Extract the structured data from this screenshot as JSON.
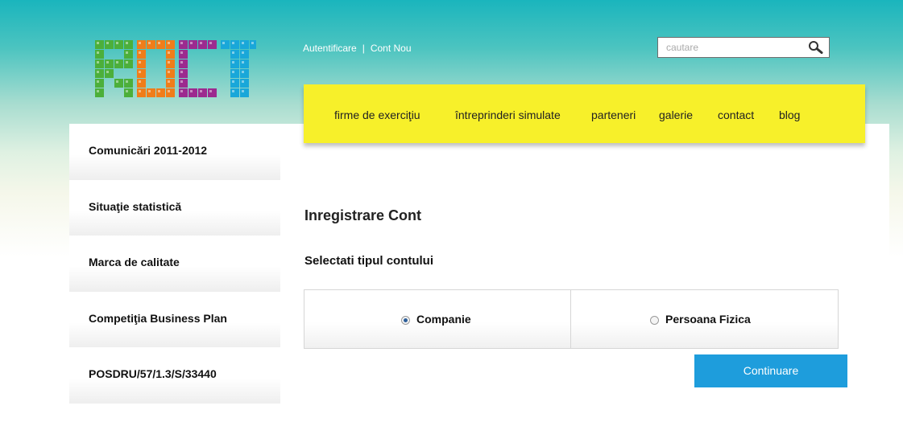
{
  "brand": {
    "logo_text": "ROCT"
  },
  "top_links": {
    "login": "Autentificare",
    "separator": "|",
    "register": "Cont Nou"
  },
  "search": {
    "placeholder": "cautare"
  },
  "nav": {
    "items": [
      {
        "label": "firme de exerciţiu"
      },
      {
        "label": "întreprinderi simulate"
      },
      {
        "label": "parteneri"
      },
      {
        "label": "galerie"
      },
      {
        "label": "contact"
      },
      {
        "label": "blog"
      }
    ]
  },
  "sidebar": {
    "items": [
      {
        "label": "Comunicări 2011-2012"
      },
      {
        "label": "Situaţie statistică"
      },
      {
        "label": "Marca de calitate"
      },
      {
        "label": "Competiţia Business Plan"
      },
      {
        "label": "POSDRU/57/1.3/S/33440"
      }
    ]
  },
  "main": {
    "title": "Inregistrare Cont",
    "subtitle": "Selectati tipul contului",
    "options": [
      {
        "label": "Companie",
        "checked": true
      },
      {
        "label": "Persoana Fizica",
        "checked": false
      }
    ],
    "continue_label": "Continuare"
  },
  "colors": {
    "header_teal": "#1ab5bd",
    "nav_yellow": "#f7f02a",
    "button_blue": "#1e9ddc",
    "logo_green": "#4caf3a",
    "logo_orange": "#f07d19",
    "logo_purple": "#9c2a8f",
    "logo_cyan": "#19a7d9"
  }
}
